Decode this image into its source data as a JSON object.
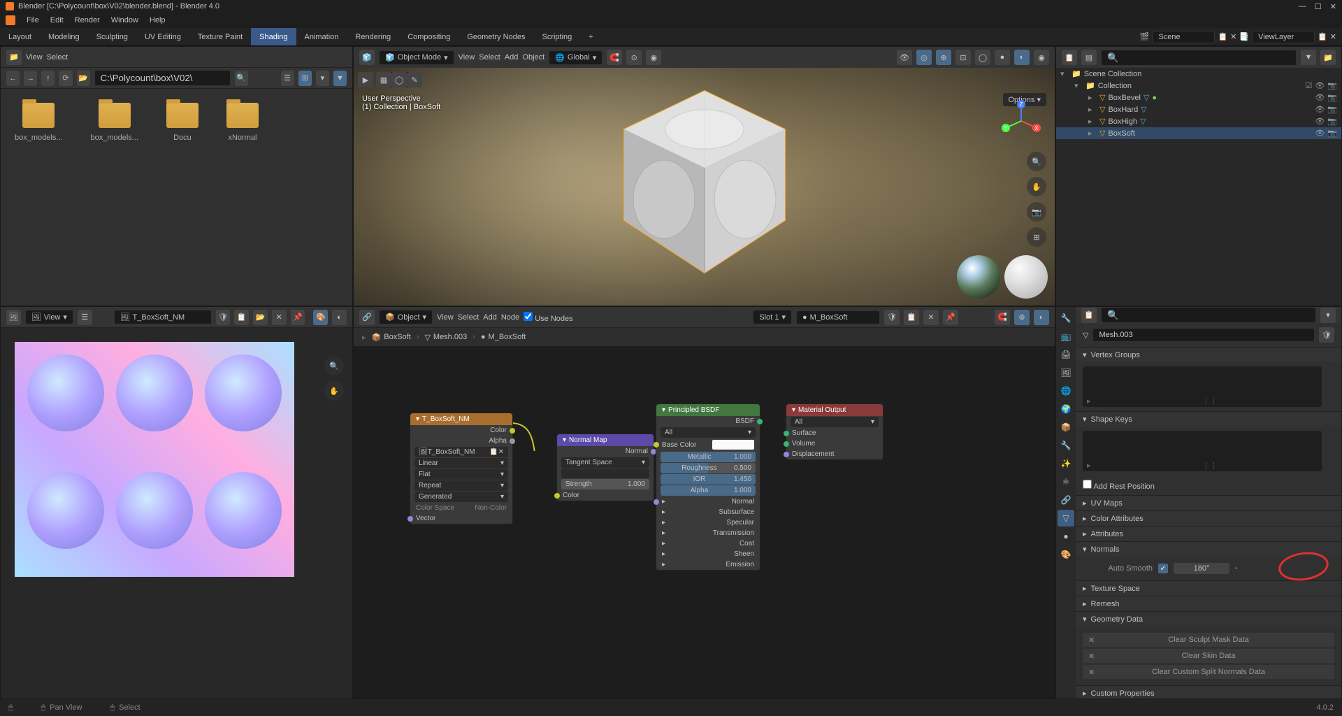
{
  "title": "Blender [C:\\Polycount\\box\\V02\\blender.blend] - Blender 4.0",
  "version": "4.0.2",
  "main_menu": [
    "File",
    "Edit",
    "Render",
    "Window",
    "Help"
  ],
  "workspaces": [
    "Layout",
    "Modeling",
    "Sculpting",
    "UV Editing",
    "Texture Paint",
    "Shading",
    "Animation",
    "Rendering",
    "Compositing",
    "Geometry Nodes",
    "Scripting"
  ],
  "active_workspace": "Shading",
  "scene_name": "Scene",
  "view_layer": "ViewLayer",
  "file_browser": {
    "menu": [
      "View",
      "Select"
    ],
    "path": "C:\\Polycount\\box\\V02\\",
    "folders": [
      "box_models...",
      "box_models...",
      "Docu",
      "xNormal"
    ]
  },
  "viewport": {
    "mode": "Object Mode",
    "menu": [
      "View",
      "Select",
      "Add",
      "Object"
    ],
    "orientation": "Global",
    "info1": "User Perspective",
    "info2": "(1) Collection | BoxSoft",
    "options_label": "Options"
  },
  "outliner": {
    "root": "Scene Collection",
    "collection": "Collection",
    "items": [
      "BoxBevel",
      "BoxHard",
      "BoxHigh",
      "BoxSoft"
    ],
    "active_item": "BoxSoft"
  },
  "image_editor": {
    "menu_view": "View",
    "image_name": "T_BoxSoft_NM"
  },
  "node_editor": {
    "menu": [
      "View",
      "Select",
      "Add",
      "Node"
    ],
    "use_nodes_label": "Use Nodes",
    "object_label": "Object",
    "slot": "Slot 1",
    "material_name": "M_BoxSoft",
    "breadcrumb": [
      "BoxSoft",
      "Mesh.003",
      "M_BoxSoft"
    ],
    "nodes": {
      "tex": {
        "title": "T_BoxSoft_NM",
        "sockets": [
          "Color",
          "Alpha"
        ],
        "image": "T_BoxSoft_NM",
        "interp": "Linear",
        "proj": "Flat",
        "ext": "Repeat",
        "source": "Generated",
        "cs_label": "Color Space",
        "cs_value": "Non-Color",
        "vector": "Vector"
      },
      "normal": {
        "title": "Normal Map",
        "out": "Normal",
        "space": "Tangent Space",
        "strength_label": "Strength",
        "strength_val": "1.000",
        "color": "Color"
      },
      "bsdf": {
        "title": "Principled BSDF",
        "out": "BSDF",
        "dist": "All",
        "base_color": "Base Color",
        "metallic": "Metallic",
        "metallic_val": "1.000",
        "roughness": "Roughness",
        "roughness_val": "0.500",
        "ior": "IOR",
        "ior_val": "1.450",
        "alpha": "Alpha",
        "alpha_val": "1.000",
        "groups": [
          "Normal",
          "Subsurface",
          "Specular",
          "Transmission",
          "Coat",
          "Sheen",
          "Emission"
        ]
      },
      "output": {
        "title": "Material Output",
        "target": "All",
        "surface": "Surface",
        "volume": "Volume",
        "disp": "Displacement"
      }
    }
  },
  "properties": {
    "mesh_name": "Mesh.003",
    "sections": {
      "vertex_groups": "Vertex Groups",
      "shape_keys": "Shape Keys",
      "add_rest": "Add Rest Position",
      "uv_maps": "UV Maps",
      "color_attrs": "Color Attributes",
      "attributes": "Attributes",
      "normals": "Normals",
      "auto_smooth": "Auto Smooth",
      "angle": "180°",
      "texture_space": "Texture Space",
      "remesh": "Remesh",
      "geo_data": "Geometry Data",
      "clear_sculpt": "Clear Sculpt Mask Data",
      "clear_skin": "Clear Skin Data",
      "clear_normals": "Clear Custom Split Normals Data",
      "custom_props": "Custom Properties"
    }
  },
  "status": {
    "pan": "Pan View",
    "select": "Select"
  }
}
